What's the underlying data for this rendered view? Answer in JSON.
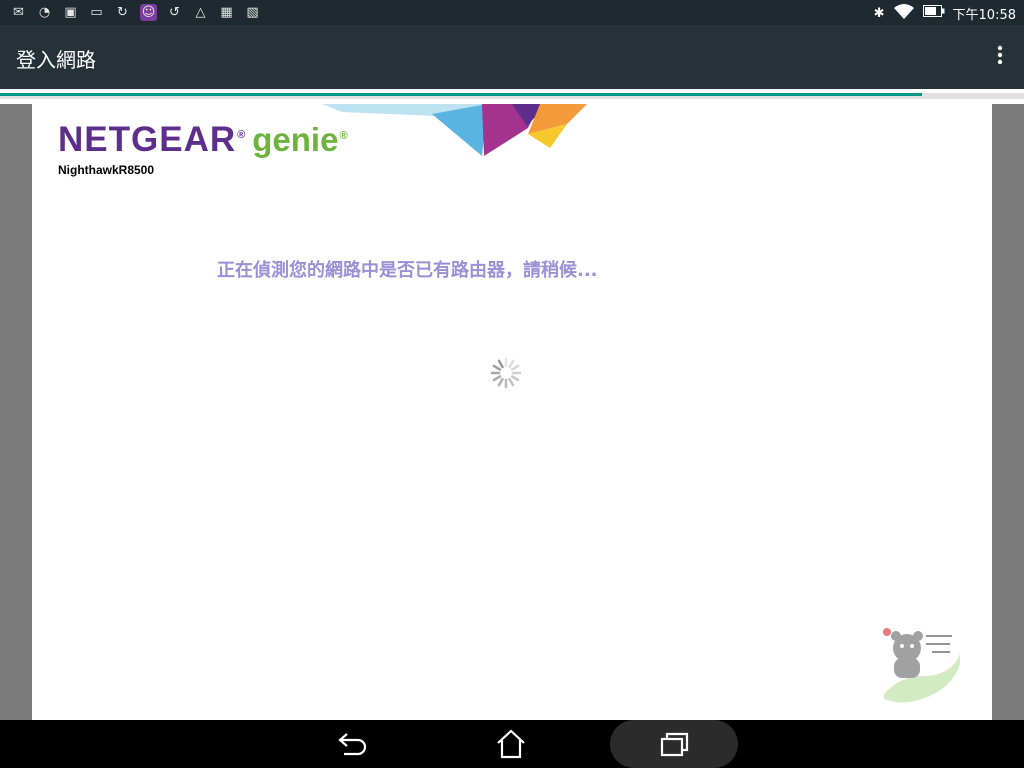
{
  "status_bar": {
    "time": "下午10:58",
    "left_icons": [
      "gmail-icon",
      "wifi-question-icon",
      "gallery-icon",
      "asus-icon",
      "sync-icon",
      "app-icon",
      "update-icon",
      "drive-icon",
      "briefcase-icon",
      "briefcase-check-icon"
    ],
    "right_icons": [
      "bluetooth-icon",
      "wifi-icon",
      "battery-icon"
    ]
  },
  "app_bar": {
    "title": "登入網路",
    "menu_icon": "more-vert-icon"
  },
  "progress": {
    "fraction": 0.9
  },
  "page": {
    "brand": "NETGEAR",
    "reg_mark": "®",
    "product": "genie",
    "model": "NighthawkR8500",
    "message": "正在偵測您的網路中是否已有路由器，請稍候..."
  },
  "nav_bar": {
    "buttons": [
      "back-icon",
      "home-icon",
      "recents-icon"
    ]
  },
  "colors": {
    "app_bar": "#263238",
    "status_bar": "#1f2a30",
    "progress": "#009688",
    "brand_purple": "#5d2e8c",
    "genie_green": "#6fb33f",
    "message": "#9b8fd6"
  }
}
